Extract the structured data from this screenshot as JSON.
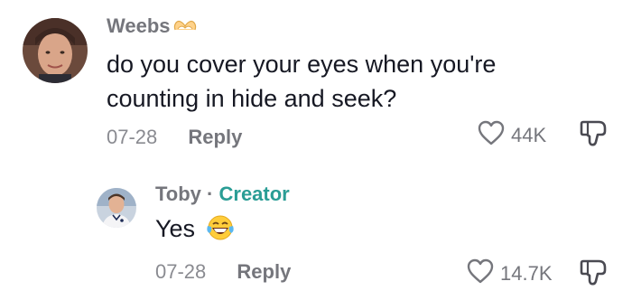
{
  "comments": [
    {
      "username": "Weebs",
      "username_emoji": "heart-hands-emoji",
      "text_lines": [
        "do you cover your eyes when you're",
        "counting in hide and seek?"
      ],
      "date": "07-28",
      "reply_label": "Reply",
      "likes": "44K"
    },
    {
      "username": "Toby",
      "separator": "·",
      "badge": "Creator",
      "text": "Yes",
      "text_emoji": "laughing-tears-emoji",
      "date": "07-28",
      "reply_label": "Reply",
      "likes": "14.7K"
    }
  ],
  "colors": {
    "username": "#75767c",
    "meta": "#8a8b91",
    "creator": "#2a9d95",
    "text": "#161823"
  }
}
